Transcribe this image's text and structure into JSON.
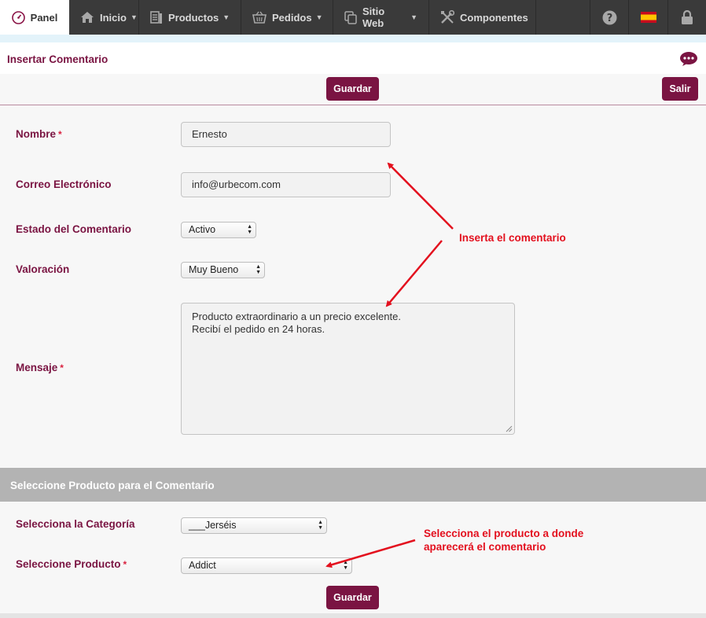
{
  "nav": {
    "panel": "Panel",
    "inicio": "Inicio",
    "productos": "Productos",
    "pedidos": "Pedidos",
    "sitio_web": "Sitio Web",
    "componentes": "Componentes"
  },
  "header": {
    "title": "Insertar Comentario"
  },
  "toolbar": {
    "save_label": "Guardar",
    "exit_label": "Salir"
  },
  "form": {
    "nombre": {
      "label": "Nombre",
      "required": "*",
      "value": "Ernesto"
    },
    "correo": {
      "label": "Correo Electrónico",
      "value": "info@urbecom.com"
    },
    "estado": {
      "label": "Estado del Comentario",
      "value": "Activo"
    },
    "valoracion": {
      "label": "Valoración",
      "value": "Muy Bueno"
    },
    "mensaje": {
      "label": "Mensaje",
      "required": "*",
      "line1": "Producto extraordinario a un precio excelente.",
      "line2": "Recibí el pedido en 24 horas."
    }
  },
  "product_section": {
    "title": "Seleccione Producto para el Comentario",
    "categoria": {
      "label": "Selecciona la Categoría",
      "value": "___Jerséis"
    },
    "producto": {
      "label": "Seleccione Producto",
      "required": "*",
      "value": "Addict"
    },
    "save_label": "Guardar"
  },
  "annotations": {
    "note1": "Inserta el comentario",
    "note2_line1": "Selecciona el producto a donde",
    "note2_line2": "aparecerá el comentario"
  },
  "colors": {
    "brand": "#7a1442",
    "annotation": "#e3101e",
    "nav_bg": "#3a3a3a"
  },
  "icons": [
    "speedometer-icon",
    "home-icon",
    "products-icon",
    "basket-icon",
    "copy-icon",
    "tools-icon",
    "help-icon",
    "spain-flag-icon",
    "lock-icon",
    "chat-icon"
  ]
}
